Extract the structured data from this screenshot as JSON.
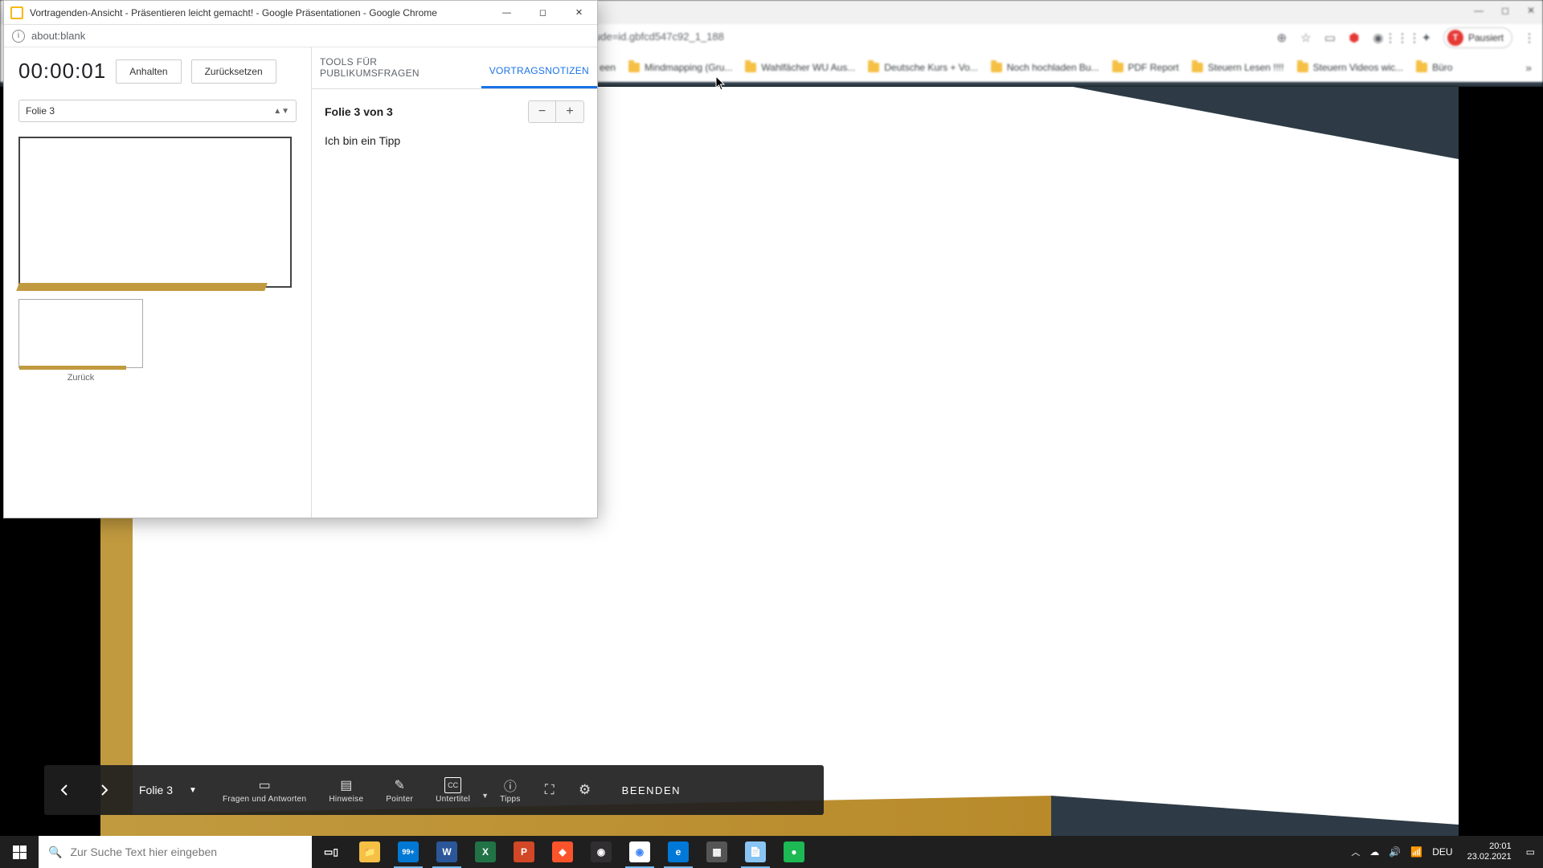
{
  "bg_chrome": {
    "url_fragment": "ude=id.gbfcd547c92_1_188",
    "pausiert": "Pausiert",
    "avatar_letter": "T",
    "bookmarks": [
      {
        "label": "een"
      },
      {
        "label": "Mindmapping  (Gru..."
      },
      {
        "label": "Wahlfächer WU Aus..."
      },
      {
        "label": "Deutsche Kurs + Vo..."
      },
      {
        "label": "Noch hochladen Bu..."
      },
      {
        "label": "PDF Report"
      },
      {
        "label": "Steuern Lesen !!!!"
      },
      {
        "label": "Steuern Videos wic..."
      },
      {
        "label": "Büro"
      }
    ]
  },
  "popup": {
    "title": "Vortragenden-Ansicht - Präsentieren leicht gemacht! - Google Präsentationen - Google Chrome",
    "url": "about:blank",
    "timer": "00:00:01",
    "btn_pause": "Anhalten",
    "btn_reset": "Zurücksetzen",
    "slide_select": "Folie 3",
    "thumb_prev_label": "Zurück",
    "tab_tools": "TOOLS FÜR PUBLIKUMSFRAGEN",
    "tab_notes": "VORTRAGSNOTIZEN",
    "notes_title": "Folie 3 von 3",
    "notes_body": "Ich bin ein Tipp"
  },
  "presenter_bar": {
    "slide_label": "Folie 3",
    "qa": "Fragen und Antworten",
    "hinweise": "Hinweise",
    "pointer": "Pointer",
    "untertitel": "Untertitel",
    "tipps": "Tipps",
    "end": "BEENDEN"
  },
  "taskbar": {
    "search_placeholder": "Zur Suche Text hier eingeben",
    "badge_99": "99+",
    "tray": {
      "lang": "DEU",
      "time": "20:01",
      "date": "23.02.2021"
    }
  }
}
